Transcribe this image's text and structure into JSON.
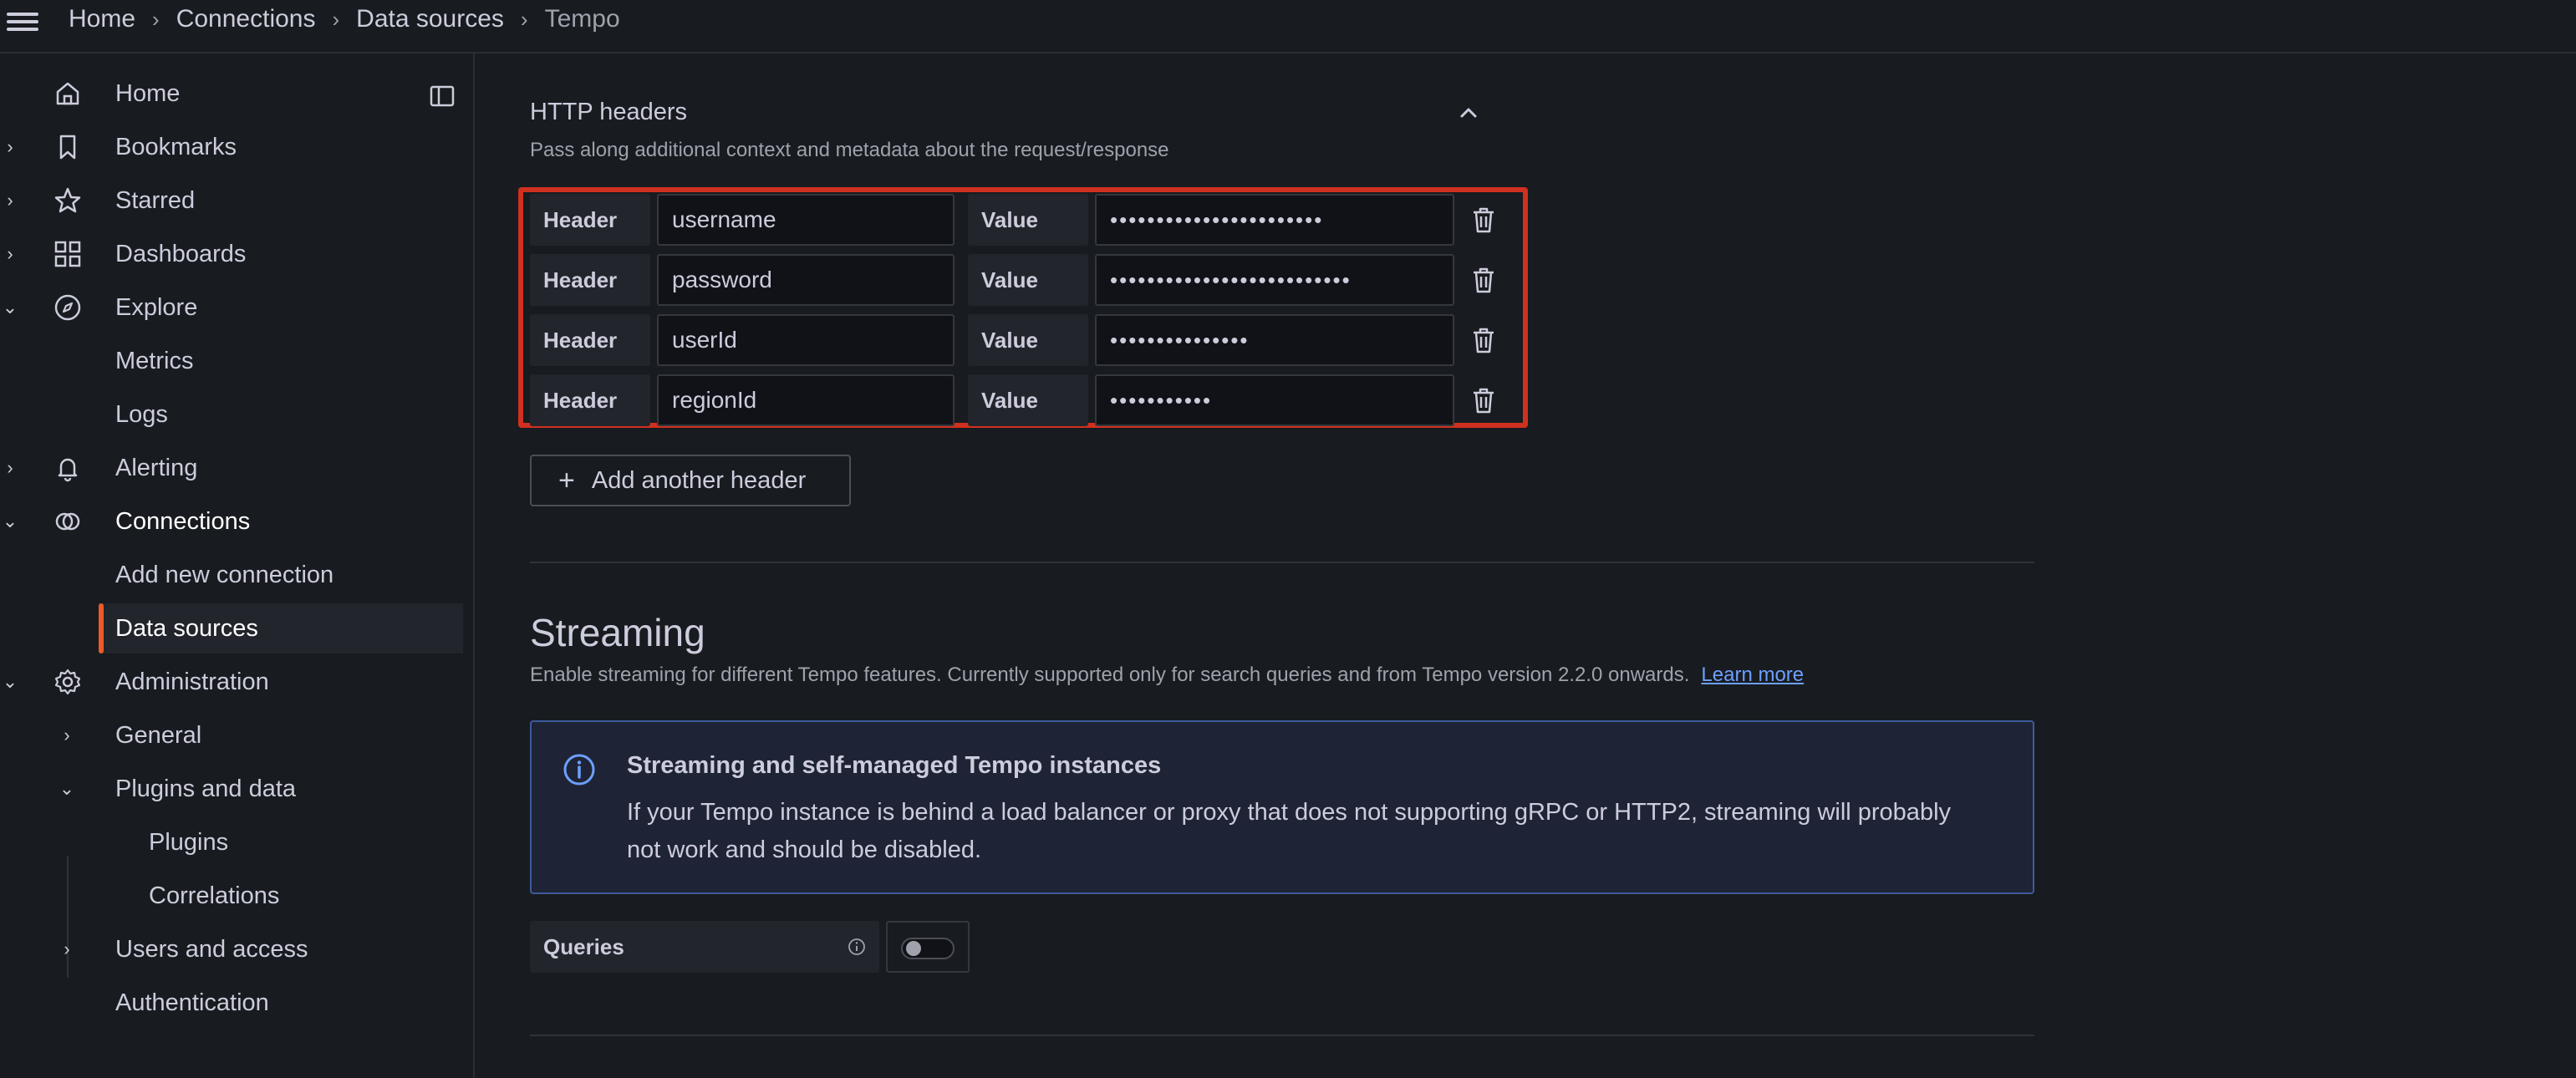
{
  "breadcrumb": [
    "Home",
    "Connections",
    "Data sources",
    "Tempo"
  ],
  "sidebar": {
    "items": [
      {
        "label": "Home",
        "icon": "home-icon"
      },
      {
        "label": "Bookmarks",
        "icon": "bookmark-icon"
      },
      {
        "label": "Starred",
        "icon": "star-icon"
      },
      {
        "label": "Dashboards",
        "icon": "apps-icon"
      },
      {
        "label": "Explore",
        "icon": "compass-icon"
      },
      {
        "label": "Metrics"
      },
      {
        "label": "Logs"
      },
      {
        "label": "Alerting",
        "icon": "bell-icon"
      },
      {
        "label": "Connections",
        "icon": "connections-icon"
      },
      {
        "label": "Add new connection"
      },
      {
        "label": "Data sources",
        "active": true
      },
      {
        "label": "Administration",
        "icon": "gear-icon"
      },
      {
        "label": "General"
      },
      {
        "label": "Plugins and data"
      },
      {
        "label": "Plugins"
      },
      {
        "label": "Correlations"
      },
      {
        "label": "Users and access"
      },
      {
        "label": "Authentication"
      }
    ]
  },
  "http_headers": {
    "title": "HTTP headers",
    "description": "Pass along additional context and metadata about the request/response",
    "header_label": "Header",
    "value_label": "Value",
    "rows": [
      {
        "header": "username",
        "value": "•••••••••••••••••••••••"
      },
      {
        "header": "password",
        "value": "••••••••••••••••••••••••••"
      },
      {
        "header": "userId",
        "value": "•••••••••••••••"
      },
      {
        "header": "regionId",
        "value": "•••••••••••"
      }
    ],
    "add_button": "Add another header"
  },
  "streaming": {
    "title": "Streaming",
    "description": "Enable streaming for different Tempo features. Currently supported only for search queries and from Tempo version 2.2.0 onwards.",
    "learn_more": "Learn more",
    "info_title": "Streaming and self-managed Tempo instances",
    "info_text": "If your Tempo instance is behind a load balancer or proxy that does not supporting gRPC or HTTP2, streaming will probably not work and should be disabled.",
    "queries_label": "Queries",
    "queries_enabled": false
  },
  "colors": {
    "background": "#181b1f",
    "accent": "#f05a28",
    "highlight": "#d0301f",
    "link": "#6e9fff"
  }
}
